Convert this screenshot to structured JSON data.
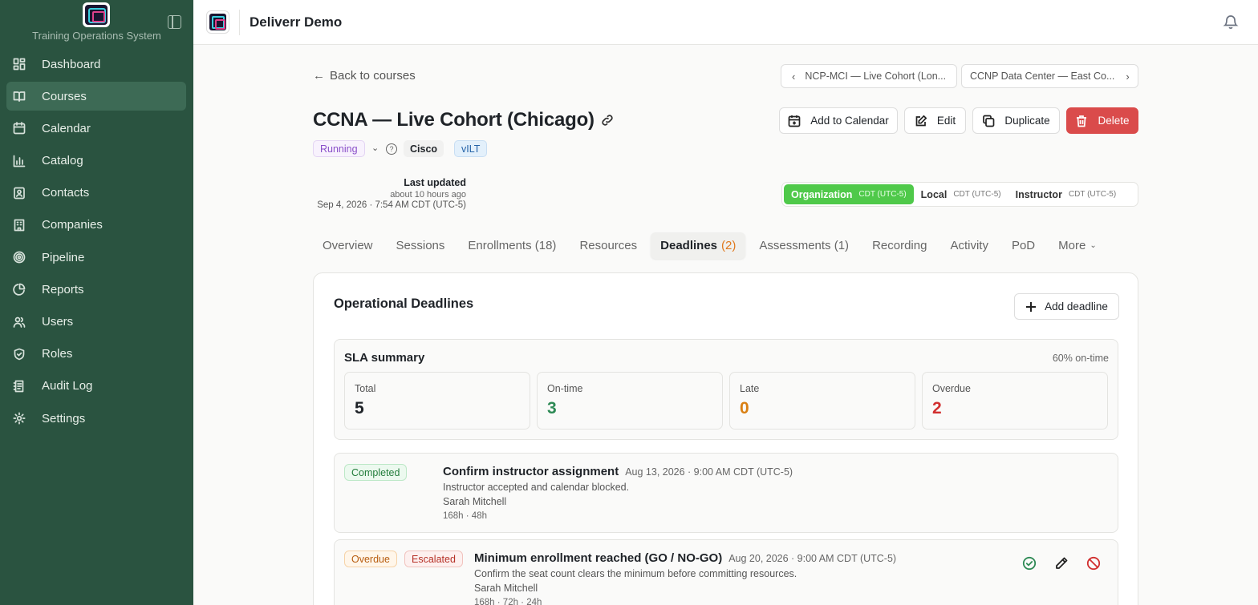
{
  "sidebar": {
    "system_title": "Training Operations System",
    "items": [
      {
        "label": "Dashboard",
        "icon": "dashboard-icon"
      },
      {
        "label": "Courses",
        "icon": "book-icon",
        "active": true
      },
      {
        "label": "Calendar",
        "icon": "calendar-icon"
      },
      {
        "label": "Catalog",
        "icon": "bar-chart-icon"
      },
      {
        "label": "Contacts",
        "icon": "contact-icon"
      },
      {
        "label": "Companies",
        "icon": "building-icon"
      },
      {
        "label": "Pipeline",
        "icon": "target-icon"
      },
      {
        "label": "Reports",
        "icon": "pie-chart-icon"
      },
      {
        "label": "Users",
        "icon": "users-icon"
      },
      {
        "label": "Roles",
        "icon": "shield-icon"
      },
      {
        "label": "Audit Log",
        "icon": "log-icon"
      },
      {
        "label": "Settings",
        "icon": "gear-icon"
      }
    ]
  },
  "topbar": {
    "workspace": "Deliverr Demo"
  },
  "nav": {
    "back": "Back to courses",
    "prev": "NCP-MCI — Live Cohort (Lon...",
    "next": "CCNP Data Center — East Co..."
  },
  "course": {
    "title": "CCNA — Live Cohort (Chicago)",
    "status": "Running",
    "vendor": "Cisco",
    "format": "vILT"
  },
  "actions": {
    "add_calendar": "Add to Calendar",
    "edit": "Edit",
    "duplicate": "Duplicate",
    "delete": "Delete"
  },
  "updated": {
    "label": "Last updated",
    "relative": "about 10 hours ago",
    "absolute": "Sep 4, 2026 · 7:54 AM CDT (UTC-5)"
  },
  "timezones": [
    {
      "label": "Organization",
      "tz": "CDT (UTC-5)",
      "active": true
    },
    {
      "label": "Local",
      "tz": "CDT (UTC-5)"
    },
    {
      "label": "Instructor",
      "tz": "CDT (UTC-5)"
    }
  ],
  "tabs": [
    {
      "label": "Overview"
    },
    {
      "label": "Sessions"
    },
    {
      "label": "Enrollments (18)"
    },
    {
      "label": "Resources"
    },
    {
      "label": "Deadlines",
      "count": "(2)",
      "active": true
    },
    {
      "label": "Assessments (1)"
    },
    {
      "label": "Recording"
    },
    {
      "label": "Activity"
    },
    {
      "label": "PoD"
    },
    {
      "label": "More"
    }
  ],
  "deadlines": {
    "title": "Operational Deadlines",
    "add_button": "Add deadline",
    "sla": {
      "title": "SLA summary",
      "pct": "60% on-time",
      "stats": [
        {
          "label": "Total",
          "value": "5",
          "color": "#1f2328"
        },
        {
          "label": "On-time",
          "value": "3",
          "color": "#2e8a55"
        },
        {
          "label": "Late",
          "value": "0",
          "color": "#d97f12"
        },
        {
          "label": "Overdue",
          "value": "2",
          "color": "#d12f2f"
        }
      ]
    },
    "rows": [
      {
        "badges": [
          "Completed"
        ],
        "title": "Confirm instructor assignment",
        "date": "Aug 13, 2026 · 9:00 AM CDT (UTC-5)",
        "desc": "Instructor accepted and calendar blocked.",
        "owner": "Sarah Mitchell",
        "sla": "168h · 48h"
      },
      {
        "badges": [
          "Overdue",
          "Escalated"
        ],
        "title": "Minimum enrollment reached (GO / NO-GO)",
        "date": "Aug 20, 2026 · 9:00 AM CDT (UTC-5)",
        "desc": "Confirm the seat count clears the minimum before committing resources.",
        "owner": "Sarah Mitchell",
        "sla": "168h · 72h · 24h"
      }
    ]
  }
}
